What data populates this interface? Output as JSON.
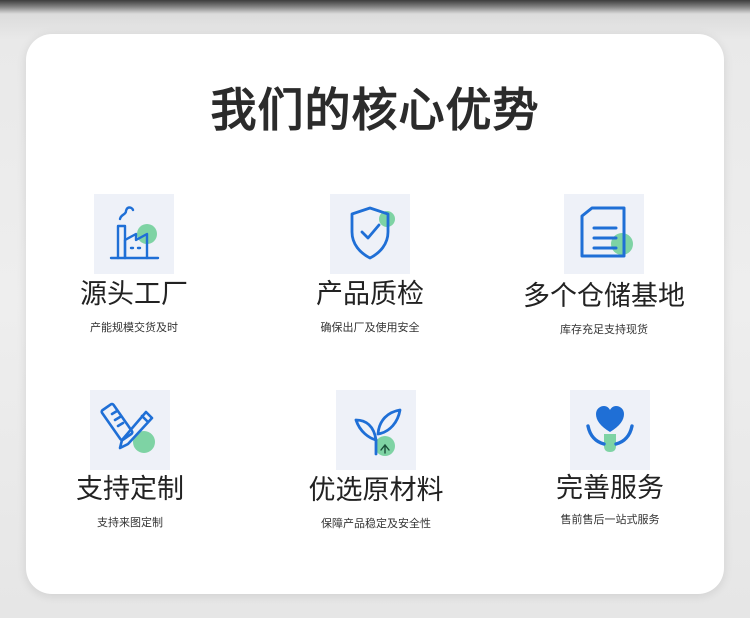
{
  "page": {
    "title": "我们的核心优势"
  },
  "colors": {
    "primary_blue": "#1f6fd6",
    "accent_green": "#7ed3a4",
    "tile_bg": "#eef1f8"
  },
  "features": [
    {
      "icon": "factory-icon",
      "title": "源头工厂",
      "desc": "产能规模交货及时"
    },
    {
      "icon": "shield-check-icon",
      "title": "产品质检",
      "desc": "确保出厂及使用安全"
    },
    {
      "icon": "warehouse-icon",
      "title": "多个仓储基地",
      "desc": "库存充足支持现货"
    },
    {
      "icon": "pencil-ruler-icon",
      "title": "支持定制",
      "desc": "支持来图定制"
    },
    {
      "icon": "sprout-icon",
      "title": "优选原材料",
      "desc": "保障产品稳定及安全性"
    },
    {
      "icon": "heart-hands-icon",
      "title": "完善服务",
      "desc": "售前售后一站式服务"
    }
  ]
}
